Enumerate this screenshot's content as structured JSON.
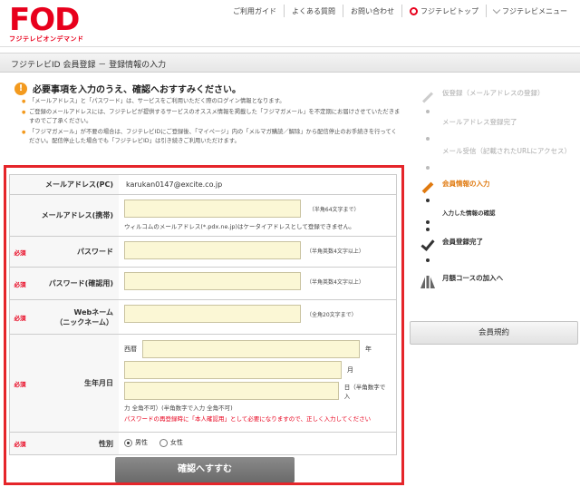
{
  "brand": {
    "logo": "FOD",
    "logo_sub": "フジテレビオンデマンド"
  },
  "topnav": [
    "ご利用ガイド",
    "よくある質問",
    "お問い合わせ",
    "フジテレビトップ",
    "フジテレビメニュー"
  ],
  "page_title": "フジテレビID 会員登録 － 登録情報の入力",
  "notice": {
    "headline": "必要事項を入力のうえ、確認へおすすみください。",
    "items": [
      "「メールアドレス」と「パスワード」は、サービスをご利用いただく際のログイン情報となります。",
      "ご登録のメールアドレスには、フジテレビが提供するサービスのオススメ情報を掲載した「フジマガメール」を不定期にお届けさせていただきますのでご了承ください。",
      "「フジマガメール」が不要の場合は、フジテレビIDにご登録後、「マイページ」内の「メルマガ購読／解除」から配信停止のお手続きを行ってください。配信停止した場合でも「フジテレビID」は引き続きご利用いただけます。"
    ]
  },
  "form": {
    "required_mark": "必須",
    "pc_email": {
      "label": "メールアドレス(PC)",
      "value": "karukan0147@excite.co.jp"
    },
    "mobile_email": {
      "label": "メールアドレス(携帯)",
      "hint": "（半角64文字まで）",
      "note": "ウィルコムのメールアドレス(*.pdx.ne.jp)はケータイアドレスとして登録できません。"
    },
    "password": {
      "label": "パスワード",
      "hint": "（半角英数4文字以上）"
    },
    "password_confirm": {
      "label": "パスワード(確認用)",
      "hint": "（半角英数4文字以上）"
    },
    "web_name": {
      "label": "Webネーム\n（ニックネーム）",
      "hint": "（全角20文字まで）"
    },
    "birthday": {
      "label": "生年月日",
      "era": "西暦",
      "year_unit": "年",
      "month_unit": "月",
      "day_unit": "日（半角数字で入",
      "note": "力 全角不可）(半角数字で入力 全角不可)",
      "red_note": "パスワードの再登録時に「本人確認用」として必要になりますので、正しく入力してください"
    },
    "gender": {
      "label": "性別",
      "male": "男性",
      "female": "女性"
    }
  },
  "confirm_button": "確認へすすむ",
  "steps": [
    {
      "text": "仮登録（メールアドレスの登録）"
    },
    {
      "text": "メールアドレス登録完了"
    },
    {
      "text": "メール受信（記載されたURLにアクセス）"
    },
    {
      "text": "会員情報の入力"
    },
    {
      "text": "入力した情報の確認"
    },
    {
      "text": "会員登録完了"
    },
    {
      "text": "月額コースの加入へ"
    }
  ],
  "terms_button": "会員規約",
  "colors": {
    "brand_red": "#e8001c",
    "accent_orange": "#e07a10",
    "input_bg": "#fbf7d5"
  }
}
